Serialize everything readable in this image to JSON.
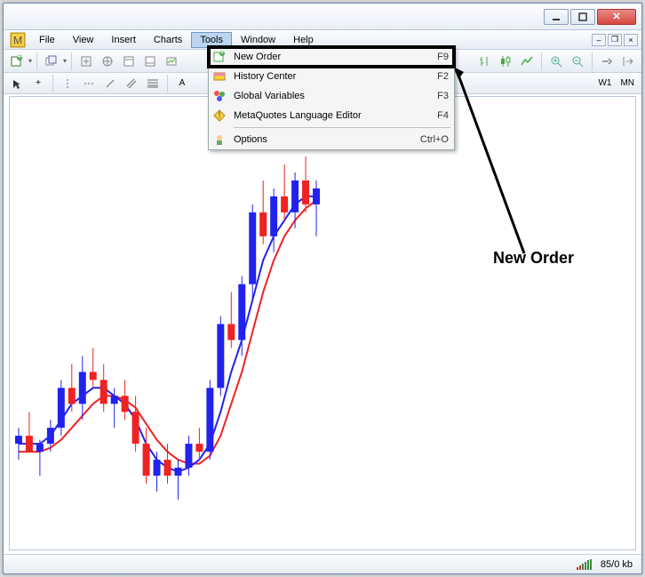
{
  "menubar": {
    "items": [
      "File",
      "View",
      "Insert",
      "Charts",
      "Tools",
      "Window",
      "Help"
    ],
    "open_index": 4
  },
  "toolbar2": {
    "timeframes": [
      "W1",
      "MN"
    ]
  },
  "dropdown": {
    "items": [
      {
        "label": "New Order",
        "shortcut": "F9",
        "icon": "new-order-icon",
        "highlight": true
      },
      {
        "label": "History Center",
        "shortcut": "F2",
        "icon": "history-icon"
      },
      {
        "label": "Global Variables",
        "shortcut": "F3",
        "icon": "variables-icon"
      },
      {
        "label": "MetaQuotes Language Editor",
        "shortcut": "F4",
        "icon": "editor-icon"
      },
      {
        "sep": true
      },
      {
        "label": "Options",
        "shortcut": "Ctrl+O",
        "icon": "options-icon"
      }
    ]
  },
  "annotation": {
    "text": "New Order"
  },
  "statusbar": {
    "connection": "85/0 kb"
  },
  "chart_data": {
    "type": "candlestick",
    "note": "No axis labels or numeric tick marks visible in screenshot; values are pixel-relative estimates on a 0-100 vertical scale (100 = top).",
    "candles": [
      {
        "x": 0,
        "o": 22,
        "h": 26,
        "l": 18,
        "c": 24,
        "color": "blue"
      },
      {
        "x": 1,
        "o": 24,
        "h": 30,
        "l": 20,
        "c": 20,
        "color": "red"
      },
      {
        "x": 2,
        "o": 20,
        "h": 23,
        "l": 14,
        "c": 22,
        "color": "blue"
      },
      {
        "x": 3,
        "o": 22,
        "h": 28,
        "l": 20,
        "c": 26,
        "color": "blue"
      },
      {
        "x": 4,
        "o": 26,
        "h": 38,
        "l": 24,
        "c": 36,
        "color": "blue"
      },
      {
        "x": 5,
        "o": 36,
        "h": 42,
        "l": 30,
        "c": 32,
        "color": "red"
      },
      {
        "x": 6,
        "o": 32,
        "h": 44,
        "l": 28,
        "c": 40,
        "color": "blue"
      },
      {
        "x": 7,
        "o": 40,
        "h": 46,
        "l": 36,
        "c": 38,
        "color": "red"
      },
      {
        "x": 8,
        "o": 38,
        "h": 42,
        "l": 30,
        "c": 32,
        "color": "red"
      },
      {
        "x": 9,
        "o": 32,
        "h": 36,
        "l": 26,
        "c": 34,
        "color": "blue"
      },
      {
        "x": 10,
        "o": 34,
        "h": 38,
        "l": 28,
        "c": 30,
        "color": "red"
      },
      {
        "x": 11,
        "o": 30,
        "h": 34,
        "l": 20,
        "c": 22,
        "color": "red"
      },
      {
        "x": 12,
        "o": 22,
        "h": 26,
        "l": 12,
        "c": 14,
        "color": "red"
      },
      {
        "x": 13,
        "o": 14,
        "h": 20,
        "l": 10,
        "c": 18,
        "color": "blue"
      },
      {
        "x": 14,
        "o": 18,
        "h": 22,
        "l": 12,
        "c": 14,
        "color": "red"
      },
      {
        "x": 15,
        "o": 14,
        "h": 18,
        "l": 8,
        "c": 16,
        "color": "blue"
      },
      {
        "x": 16,
        "o": 16,
        "h": 24,
        "l": 14,
        "c": 22,
        "color": "blue"
      },
      {
        "x": 17,
        "o": 22,
        "h": 26,
        "l": 18,
        "c": 20,
        "color": "red"
      },
      {
        "x": 18,
        "o": 20,
        "h": 38,
        "l": 18,
        "c": 36,
        "color": "blue"
      },
      {
        "x": 19,
        "o": 36,
        "h": 54,
        "l": 34,
        "c": 52,
        "color": "blue"
      },
      {
        "x": 20,
        "o": 52,
        "h": 60,
        "l": 46,
        "c": 48,
        "color": "red"
      },
      {
        "x": 21,
        "o": 48,
        "h": 64,
        "l": 44,
        "c": 62,
        "color": "blue"
      },
      {
        "x": 22,
        "o": 62,
        "h": 82,
        "l": 58,
        "c": 80,
        "color": "blue"
      },
      {
        "x": 23,
        "o": 80,
        "h": 88,
        "l": 72,
        "c": 74,
        "color": "red"
      },
      {
        "x": 24,
        "o": 74,
        "h": 86,
        "l": 70,
        "c": 84,
        "color": "blue"
      },
      {
        "x": 25,
        "o": 84,
        "h": 92,
        "l": 78,
        "c": 80,
        "color": "red"
      },
      {
        "x": 26,
        "o": 80,
        "h": 90,
        "l": 76,
        "c": 88,
        "color": "blue"
      },
      {
        "x": 27,
        "o": 88,
        "h": 94,
        "l": 80,
        "c": 82,
        "color": "red"
      },
      {
        "x": 28,
        "o": 82,
        "h": 88,
        "l": 74,
        "c": 86,
        "color": "blue"
      }
    ],
    "ma_blue": [
      22,
      22,
      22,
      24,
      28,
      32,
      34,
      36,
      36,
      34,
      32,
      28,
      22,
      18,
      16,
      15,
      16,
      18,
      22,
      30,
      40,
      48,
      58,
      68,
      74,
      78,
      82,
      84,
      84
    ],
    "ma_red": [
      20,
      20,
      20,
      21,
      23,
      26,
      29,
      32,
      34,
      34,
      33,
      31,
      27,
      23,
      20,
      18,
      17,
      17,
      19,
      24,
      32,
      40,
      50,
      60,
      68,
      74,
      78,
      81,
      83
    ]
  }
}
